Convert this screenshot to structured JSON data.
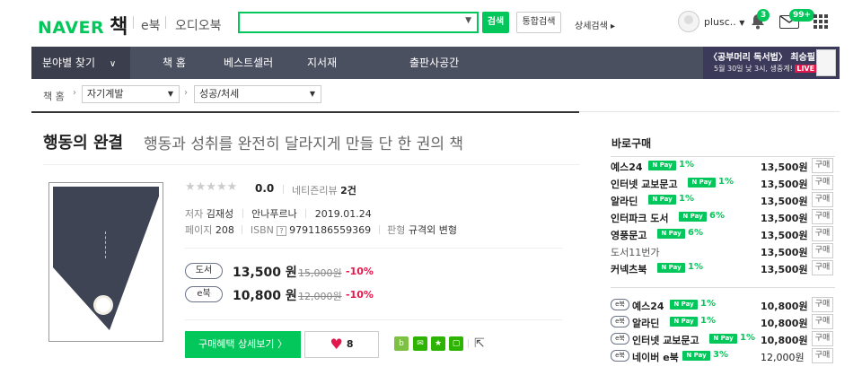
{
  "header": {
    "logo_naver": "NAVER",
    "logo_book": "책",
    "nav_ebook": "e북",
    "nav_audio": "오디오북",
    "search_value": "",
    "search_button": "검색",
    "integrated_search": "통합검색",
    "advanced_search": "상세검색 ▸",
    "user_name": "plusc..",
    "bell_count": "3",
    "mail_count": "99+"
  },
  "nav": {
    "category": "분야별 찾기",
    "items": [
      "책 홈",
      "베스트셀러",
      "지서재",
      "출판사공간"
    ],
    "banner_title": "〈공부머리 독서법〉 최승필",
    "banner_sub": "5월 30일 낮 3시, 생중계!",
    "banner_live": "LIVE"
  },
  "breadcrumb": {
    "home": "책 홈",
    "level1": "자기계발",
    "level2": "성공/처세"
  },
  "book": {
    "title": "행동의 완결",
    "subtitle": "행동과 성취를 완전히 달라지게 만들 단 한 권의 책",
    "stars": "★★★★★",
    "rating": "0.0",
    "review_label": "네티즌리뷰",
    "review_count": "2건",
    "author_label": "저자",
    "author": "김재성",
    "publisher": "안나푸르나",
    "date": "2019.01.24",
    "pages_label": "페이지",
    "pages": "208",
    "isbn_label": "ISBN",
    "isbn_q": "?",
    "isbn": "9791186559369",
    "format_label": "판형",
    "format": "규격외 변형"
  },
  "prices": {
    "paper_tag": "도서",
    "paper_price": "13,500 원",
    "paper_orig": "15,000원",
    "paper_disc": "-10%",
    "ebook_tag": "e북",
    "ebook_price": "10,800 원",
    "ebook_orig": "12,000원",
    "ebook_disc": "-10%"
  },
  "actions": {
    "buy_detail": "구매혜택 상세보기 〉",
    "like_count": "8"
  },
  "direct_buy": {
    "title": "바로구매",
    "npay": "N Pay",
    "buy_label": "구매",
    "ebook_tag": "e북",
    "paper": [
      {
        "store": "예스24",
        "pct": "1%",
        "price": "13,500원"
      },
      {
        "store": "인터넷 교보문고",
        "pct": "1%",
        "price": "13,500원"
      },
      {
        "store": "알라딘",
        "pct": "1%",
        "price": "13,500원"
      },
      {
        "store": "인터파크 도서",
        "pct": "6%",
        "price": "13,500원"
      },
      {
        "store": "영풍문고",
        "pct": "6%",
        "price": "13,500원"
      },
      {
        "store": "도서11번가",
        "pct": "",
        "price": "13,500원"
      },
      {
        "store": "커넥츠북",
        "pct": "1%",
        "price": "13,500원"
      }
    ],
    "ebook": [
      {
        "store": "예스24",
        "pct": "1%",
        "price": "10,800원"
      },
      {
        "store": "알라딘",
        "pct": "1%",
        "price": "10,800원"
      },
      {
        "store": "인터넷 교보문고",
        "pct": "1%",
        "price": "10,800원"
      },
      {
        "store": "네이버 e북",
        "pct": "3%",
        "price": "12,000원"
      }
    ]
  }
}
